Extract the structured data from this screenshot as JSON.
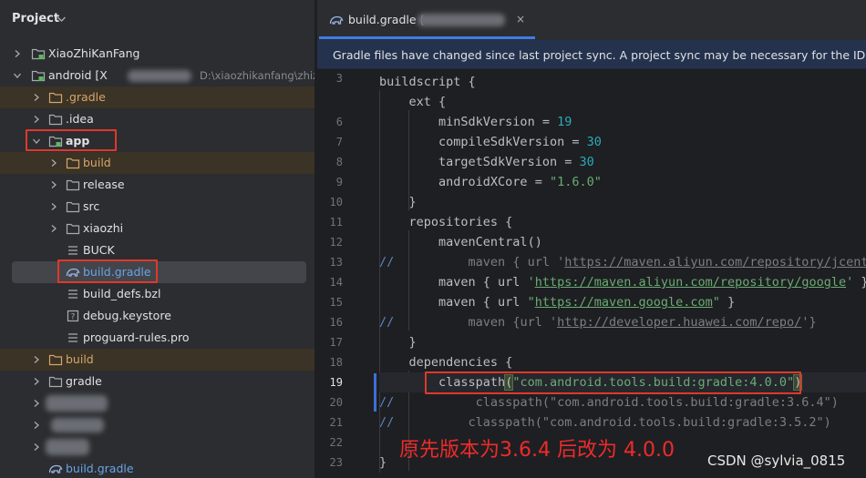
{
  "project_panel": {
    "title": "Project",
    "tree": [
      {
        "label": "XiaoZhiKanFang",
        "kind": "module"
      },
      {
        "label": "android [X",
        "path": "D:\\xiaozhikanfang\\zhiz",
        "kind": "module"
      },
      {
        "label": ".gradle",
        "kind": "folder-excluded"
      },
      {
        "label": ".idea",
        "kind": "folder"
      },
      {
        "label": "app",
        "kind": "module"
      },
      {
        "label": "build",
        "kind": "folder-excluded"
      },
      {
        "label": "release",
        "kind": "folder"
      },
      {
        "label": "src",
        "kind": "folder"
      },
      {
        "label": "xiaozhi",
        "kind": "folder"
      },
      {
        "label": "BUCK",
        "kind": "file"
      },
      {
        "label": "build.gradle",
        "kind": "gradle-file"
      },
      {
        "label": "build_defs.bzl",
        "kind": "file"
      },
      {
        "label": "debug.keystore",
        "kind": "file"
      },
      {
        "label": "proguard-rules.pro",
        "kind": "file"
      },
      {
        "label": "build",
        "kind": "folder-excluded"
      },
      {
        "label": "gradle",
        "kind": "folder"
      },
      {
        "label": "build.gradle",
        "kind": "gradle-file"
      }
    ]
  },
  "editor": {
    "tab": {
      "label": "build.gradle (",
      "close": "×"
    },
    "banner": "Gradle files have changed since last project sync. A project sync may be necessary for the IDE to wor",
    "line_numbers": [
      "3",
      "6",
      "7",
      "8",
      "9",
      "10",
      "11",
      "12",
      "13",
      "14",
      "15",
      "16",
      "17",
      "18",
      "19",
      "20",
      "21",
      "22",
      "23"
    ],
    "current_line": "19",
    "code": {
      "l3_kw": "buildscript {",
      "l4_kw": "ext {",
      "l6_a": "minSdkVersion = ",
      "l6_n": "19",
      "l7_a": "compileSdkVersion = ",
      "l7_n": "30",
      "l8_a": "targetSdkVersion = ",
      "l8_n": "30",
      "l9_a": "androidXCore = ",
      "l9_s": "\"1.6.0\"",
      "l10": "}",
      "l11": "repositories {",
      "l12": "mavenCentral()",
      "l13_c": "//",
      "l13_a": "maven { url '",
      "l13_u": "https://maven.aliyun.com/repository/jcenter",
      "l14_a": "maven { url ",
      "l14_q1": "'",
      "l14_u": "https://maven.aliyun.com/repository/google",
      "l14_q2": "'",
      "l14_b": " }",
      "l15_a": "maven { url ",
      "l15_q1": "\"",
      "l15_u": "https://maven.google.com",
      "l15_q2": "\"",
      "l15_b": " }",
      "l16_c": "//",
      "l16_a": "maven {url '",
      "l16_u": "http://developer.huawei.com/repo/",
      "l16_b": "'}",
      "l17": "}",
      "l18": "dependencies {",
      "l19_a": "classpath",
      "l19_p1": "(",
      "l19_s": "\"com.android.tools.build:gradle:4.0.0\"",
      "l19_p2": ")",
      "l20_c": "//",
      "l20_a": "classpath(\"com.android.tools.build:gradle:3.6.4\")",
      "l21_c": "//",
      "l21_a": "classpath(\"com.android.tools.build:gradle:3.5.2\")",
      "l23": "}"
    }
  },
  "annotation": "原先版本为3.6.4 后改为 4.0.0",
  "watermark": "CSDN @sylvia_0815",
  "colors": {
    "annotation_red": "#ee2b2b",
    "highlight_box": "#e0382b",
    "accent_blue": "#3d7ee8",
    "excluded_folder": "#d6a56a"
  }
}
